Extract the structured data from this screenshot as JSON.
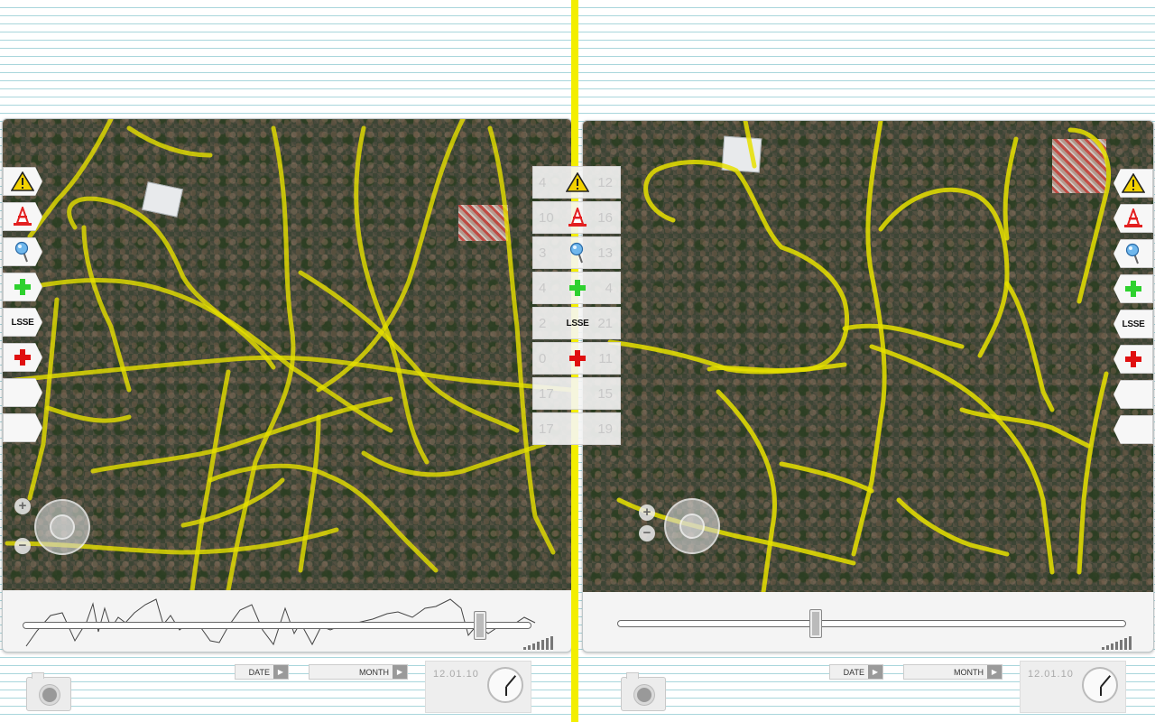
{
  "layers": [
    {
      "id": "warning",
      "icon": "warning-triangle-icon"
    },
    {
      "id": "cone",
      "icon": "traffic-cone-icon"
    },
    {
      "id": "pin",
      "icon": "map-pin-icon"
    },
    {
      "id": "health",
      "icon": "green-cross-icon"
    },
    {
      "id": "lsse",
      "icon": "lsse-logo",
      "label": "LSSE"
    },
    {
      "id": "medical",
      "icon": "red-cross-icon"
    },
    {
      "id": "empty1",
      "icon": "blank"
    },
    {
      "id": "empty2",
      "icon": "blank"
    }
  ],
  "compare": [
    {
      "left": "4",
      "right": "12",
      "icon": "warning-triangle-icon"
    },
    {
      "left": "10",
      "right": "16",
      "icon": "traffic-cone-icon"
    },
    {
      "left": "3",
      "right": "13",
      "icon": "map-pin-icon"
    },
    {
      "left": "4",
      "right": "4",
      "icon": "green-cross-icon"
    },
    {
      "left": "2",
      "right": "21",
      "icon": "lsse-logo",
      "label": "LSSE"
    },
    {
      "left": "0",
      "right": "11",
      "icon": "red-cross-icon"
    },
    {
      "left": "17",
      "right": "15",
      "icon": "blank"
    },
    {
      "left": "17",
      "right": "19",
      "icon": "blank"
    }
  ],
  "panels": {
    "left": {
      "slider_value": 0.9,
      "has_sparkline": true,
      "zoom_in": "+",
      "zoom_out": "−"
    },
    "right": {
      "slider_value": 0.39,
      "has_sparkline": false,
      "zoom_in": "+",
      "zoom_out": "−"
    }
  },
  "controls": {
    "left": {
      "date_label": "DATE",
      "month_label": "MONTH",
      "date_value": "12.01.10"
    },
    "right": {
      "date_label": "DATE",
      "month_label": "MONTH",
      "date_value": "12.01.10"
    }
  },
  "colors": {
    "road": "#e6e000",
    "divider": "#f3ee00",
    "cross_green": "#2ed12e",
    "cross_red": "#e01010",
    "warning": "#f2d100",
    "cone": "#e32020"
  }
}
